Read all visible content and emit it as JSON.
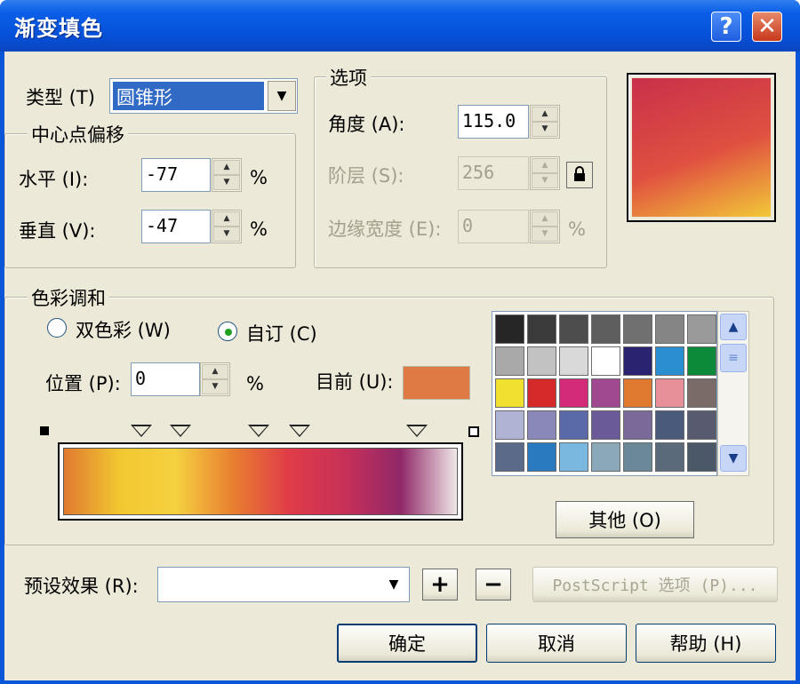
{
  "window": {
    "title": "渐变填色",
    "help_glyph": "?",
    "close_glyph": "✕"
  },
  "type_row": {
    "label": "类型 (T)",
    "value": "圆锥形"
  },
  "center_offset": {
    "title": "中心点偏移",
    "horizontal": {
      "label": "水平 (I):",
      "value": "-77",
      "unit": "%"
    },
    "vertical": {
      "label": "垂直 (V):",
      "value": "-47",
      "unit": "%"
    }
  },
  "options": {
    "title": "选项",
    "angle": {
      "label": "角度 (A):",
      "value": "115.0"
    },
    "steps": {
      "label": "阶层 (S):",
      "value": "256"
    },
    "edge_pad": {
      "label": "边缘宽度 (E):",
      "value": "0",
      "unit": "%"
    }
  },
  "preview": {
    "colors": [
      "#c8304a",
      "#e05040",
      "#f2c838"
    ]
  },
  "color_blend": {
    "title": "色彩调和",
    "two_color": {
      "label": "双色彩 (W)",
      "checked": false
    },
    "custom": {
      "label": "自订 (C)",
      "checked": true
    },
    "position": {
      "label": "位置 (P):",
      "value": "0",
      "unit": "%"
    },
    "current": {
      "label": "目前 (U):",
      "color": "#e07a45"
    },
    "gradient_stops": [
      "#e07a30",
      "#f2c830",
      "#f5d040",
      "#e88030",
      "#e03c48",
      "#c83058",
      "#902868",
      "#f0e8e8"
    ],
    "other_button": "其他 (O)"
  },
  "palette": [
    [
      "#262626",
      "#3b3b3b",
      "#4d4d4d",
      "#5e5e5e",
      "#707070",
      "#858585",
      "#9a9a9a"
    ],
    [
      "#a9a9a9",
      "#c2c2c2",
      "#d9d9d9",
      "#ffffff",
      "#2a2470",
      "#2a8ed0",
      "#0c8a3a"
    ],
    [
      "#f0e030",
      "#d42a2a",
      "#d42a7a",
      "#a04890",
      "#e07a30",
      "#e8909a",
      "#7a6a68"
    ],
    [
      "#b0b4d4",
      "#8a88b8",
      "#5a6aa8",
      "#6a5a98",
      "#7a6a9a",
      "#4a5a7a",
      "#585a70"
    ],
    [
      "#5a6a88",
      "#2a7ac0",
      "#7ab8e0",
      "#8aa8b8",
      "#6a8898",
      "#5a6a7a",
      "#4a5868"
    ]
  ],
  "presets": {
    "label": "预设效果 (R):",
    "value": "",
    "add_glyph": "+",
    "remove_glyph": "−",
    "postscript_button": "PostScript 选项 (P)..."
  },
  "buttons": {
    "ok": "确定",
    "cancel": "取消",
    "help": "帮助 (H)"
  }
}
